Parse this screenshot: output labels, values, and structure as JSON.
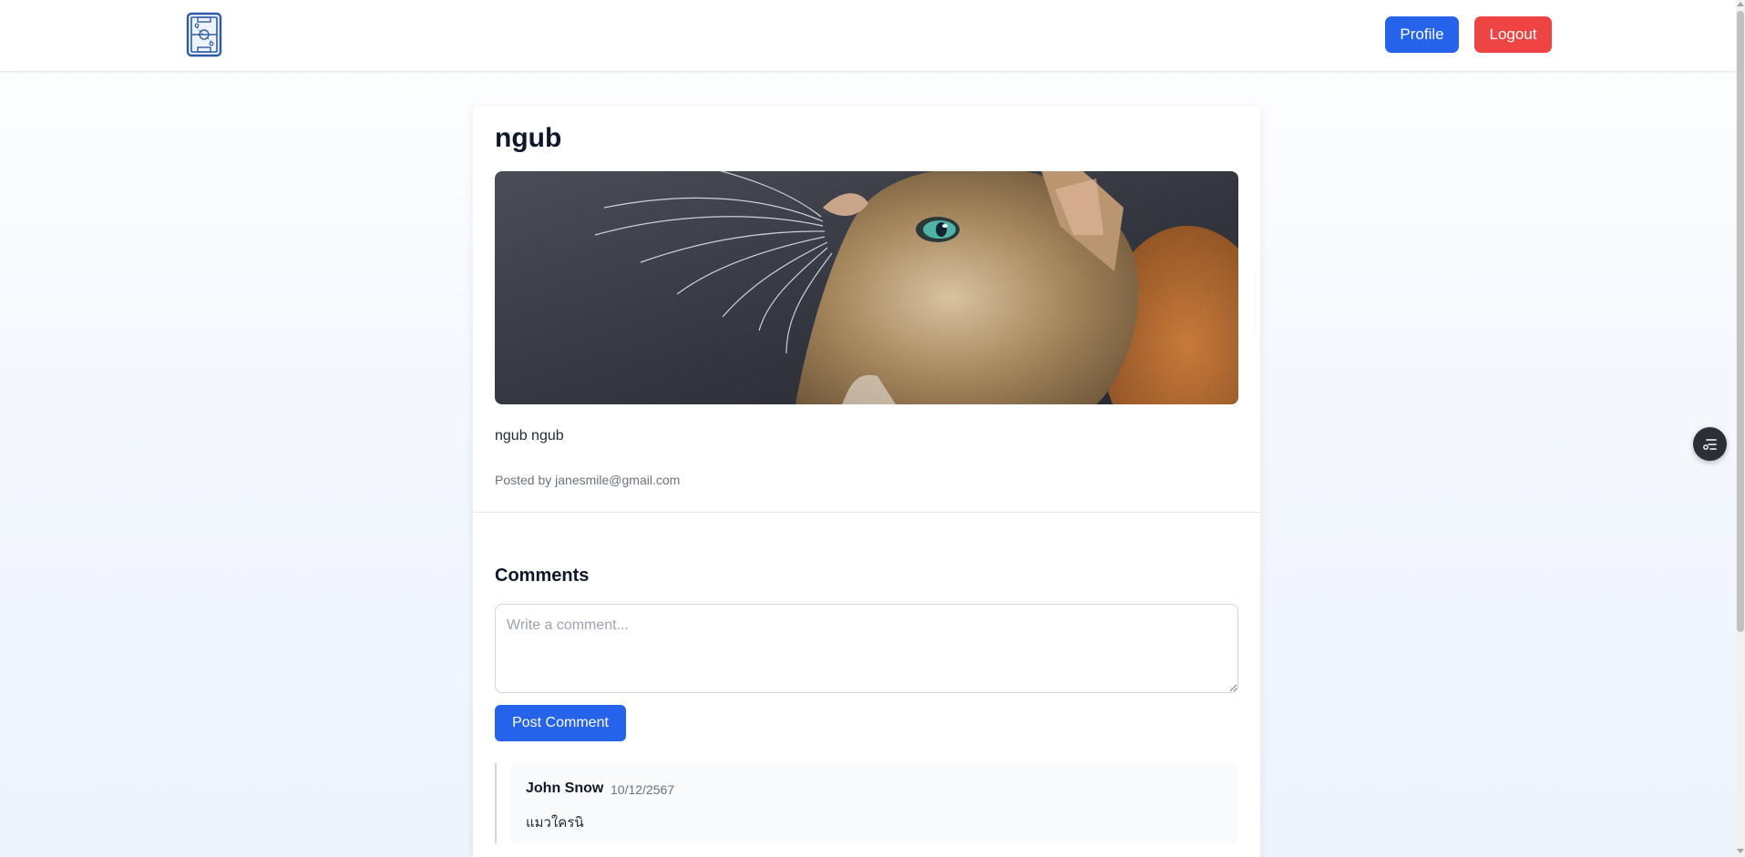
{
  "header": {
    "logo_icon": "football-pitch-logo-icon",
    "profile_label": "Profile",
    "logout_label": "Logout",
    "colors": {
      "profile": "#2563eb",
      "logout": "#ef4444"
    }
  },
  "post": {
    "title": "ngub",
    "image_icon": "cat-photo",
    "body": "ngub ngub",
    "posted_by_prefix": "Posted by",
    "author": "janesmile@gmail.com"
  },
  "comments": {
    "heading": "Comments",
    "input_placeholder": "Write a comment...",
    "input_value": "",
    "submit_label": "Post Comment",
    "items": [
      {
        "author": "John Snow",
        "date": "10/12/2567",
        "text": "แมวใครนิ"
      }
    ]
  },
  "floating_button": {
    "icon": "filter-settings-icon"
  }
}
